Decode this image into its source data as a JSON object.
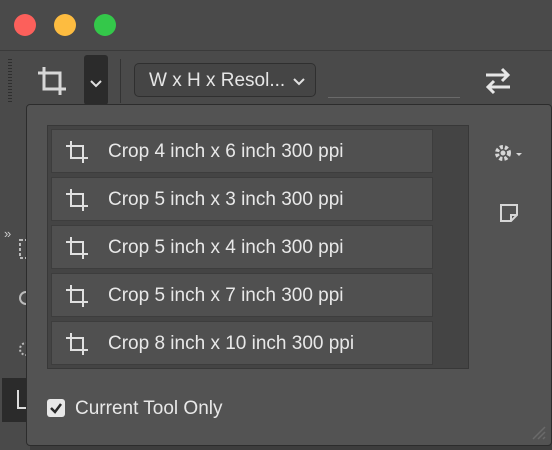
{
  "window": {
    "traffic_lights": [
      "close",
      "minimize",
      "maximize"
    ]
  },
  "options_bar": {
    "tool_icon": "crop-icon",
    "ratio_select_value": "W x H x Resol...",
    "swap_icon": "swap-arrows-icon"
  },
  "left_toolbar": {
    "collapse_label": "»"
  },
  "preset_popup": {
    "presets": [
      {
        "label": "Crop 4 inch x 6 inch 300 ppi",
        "icon": "crop-icon"
      },
      {
        "label": "Crop 5 inch x 3 inch 300 ppi",
        "icon": "crop-icon"
      },
      {
        "label": "Crop 5 inch x 4 inch 300 ppi",
        "icon": "crop-icon"
      },
      {
        "label": "Crop 5 inch x 7 inch 300 ppi",
        "icon": "crop-icon"
      },
      {
        "label": "Crop 8 inch x 10 inch 300 ppi",
        "icon": "crop-icon"
      }
    ],
    "gear_icon": "gear-icon",
    "new_preset_icon": "new-preset-icon",
    "current_tool_only_label": "Current Tool Only",
    "current_tool_only_checked": true
  },
  "colors": {
    "panel_bg": "#535353",
    "list_bg": "#444444",
    "item_bg": "#505050",
    "text": "#e8e8e8"
  }
}
